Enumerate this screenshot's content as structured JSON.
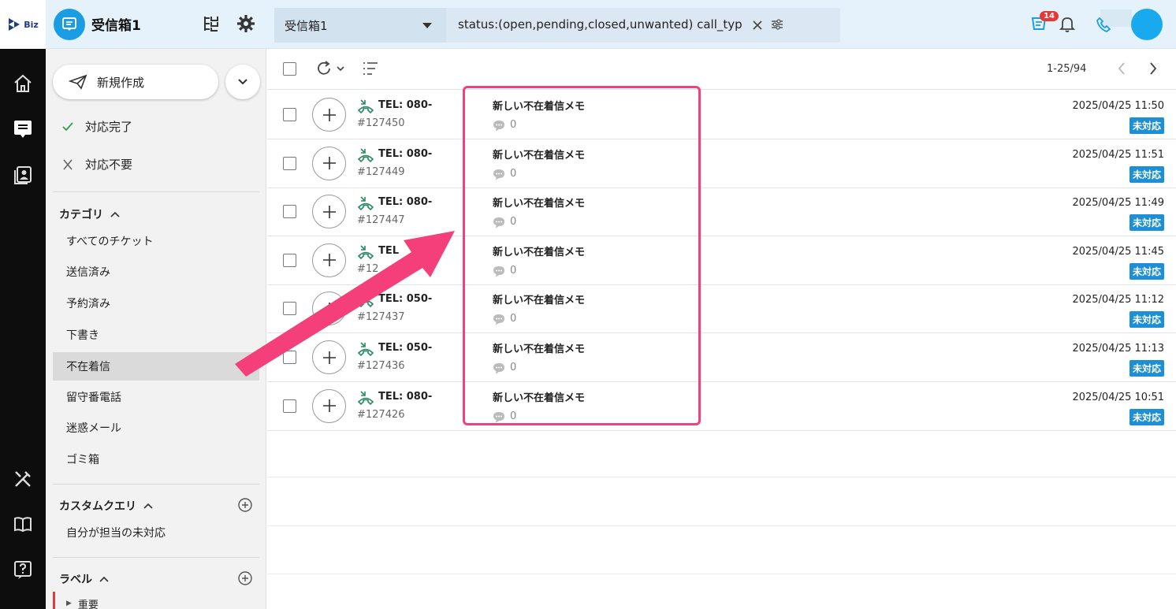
{
  "brand": {
    "logo_text": "Biz"
  },
  "header": {
    "inbox_title": "受信箱1",
    "search_inbox": "受信箱1",
    "query": "status:(open,pending,closed,unwanted) call_typ",
    "notif_count": "14"
  },
  "sidebar": {
    "compose_label": "新規作成",
    "status_items": [
      {
        "label": "対応完了"
      },
      {
        "label": "対応不要"
      }
    ],
    "category_title": "カテゴリ",
    "categories": [
      {
        "label": "すべてのチケット"
      },
      {
        "label": "送信済み"
      },
      {
        "label": "予約済み"
      },
      {
        "label": "下書き"
      },
      {
        "label": "不在着信"
      },
      {
        "label": "留守番電話"
      },
      {
        "label": "迷惑メール"
      },
      {
        "label": "ゴミ箱"
      }
    ],
    "custom_title": "カスタムクエリ",
    "custom_items": [
      {
        "label": "自分が担当の未対応"
      }
    ],
    "label_title": "ラベル",
    "label_items": [
      {
        "label": "重要"
      }
    ]
  },
  "main": {
    "paging": "1-25/94",
    "rows": [
      {
        "tel": "TEL: 080-",
        "id": "#127450",
        "subject": "新しい不在着信メモ",
        "comments": "0",
        "date": "2025/04/25 11:50",
        "status": "未対応"
      },
      {
        "tel": "TEL: 080-",
        "id": "#127449",
        "subject": "新しい不在着信メモ",
        "comments": "0",
        "date": "2025/04/25 11:51",
        "status": "未対応"
      },
      {
        "tel": "TEL: 080-",
        "id": "#127447",
        "subject": "新しい不在着信メモ",
        "comments": "0",
        "date": "2025/04/25 11:49",
        "status": "未対応"
      },
      {
        "tel": "TEL",
        "id": "#12",
        "subject": "新しい不在着信メモ",
        "comments": "0",
        "date": "2025/04/25 11:45",
        "status": "未対応"
      },
      {
        "tel": "TEL: 050-",
        "id": "#127437",
        "subject": "新しい不在着信メモ",
        "comments": "0",
        "date": "2025/04/25 11:12",
        "status": "未対応"
      },
      {
        "tel": "TEL: 050-",
        "id": "#127436",
        "subject": "新しい不在着信メモ",
        "comments": "0",
        "date": "2025/04/25 11:13",
        "status": "未対応"
      },
      {
        "tel": "TEL: 080-",
        "id": "#127426",
        "subject": "新しい不在着信メモ",
        "comments": "0",
        "date": "2025/04/25 10:51",
        "status": "未対応"
      }
    ]
  },
  "colors": {
    "accent": "#1b9de4",
    "annotation": "#f43f7a",
    "status_badge": "#1c8fd6"
  }
}
